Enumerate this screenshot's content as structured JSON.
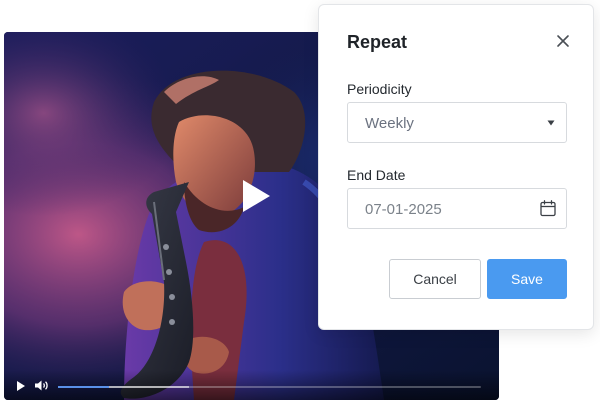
{
  "video": {
    "playback_progress": 0.12,
    "buffered_progress": 0.31,
    "accent_color": "#5a90e8"
  },
  "dialog": {
    "title": "Repeat",
    "close_icon": "close-icon",
    "periodicity": {
      "label": "Periodicity",
      "value": "Weekly",
      "caret_icon": "caret-down-icon"
    },
    "end_date": {
      "label": "End Date",
      "value": "07-01-2025",
      "icon": "calendar-icon"
    },
    "buttons": {
      "cancel": "Cancel",
      "save": "Save",
      "save_color": "#4a9af0"
    }
  }
}
